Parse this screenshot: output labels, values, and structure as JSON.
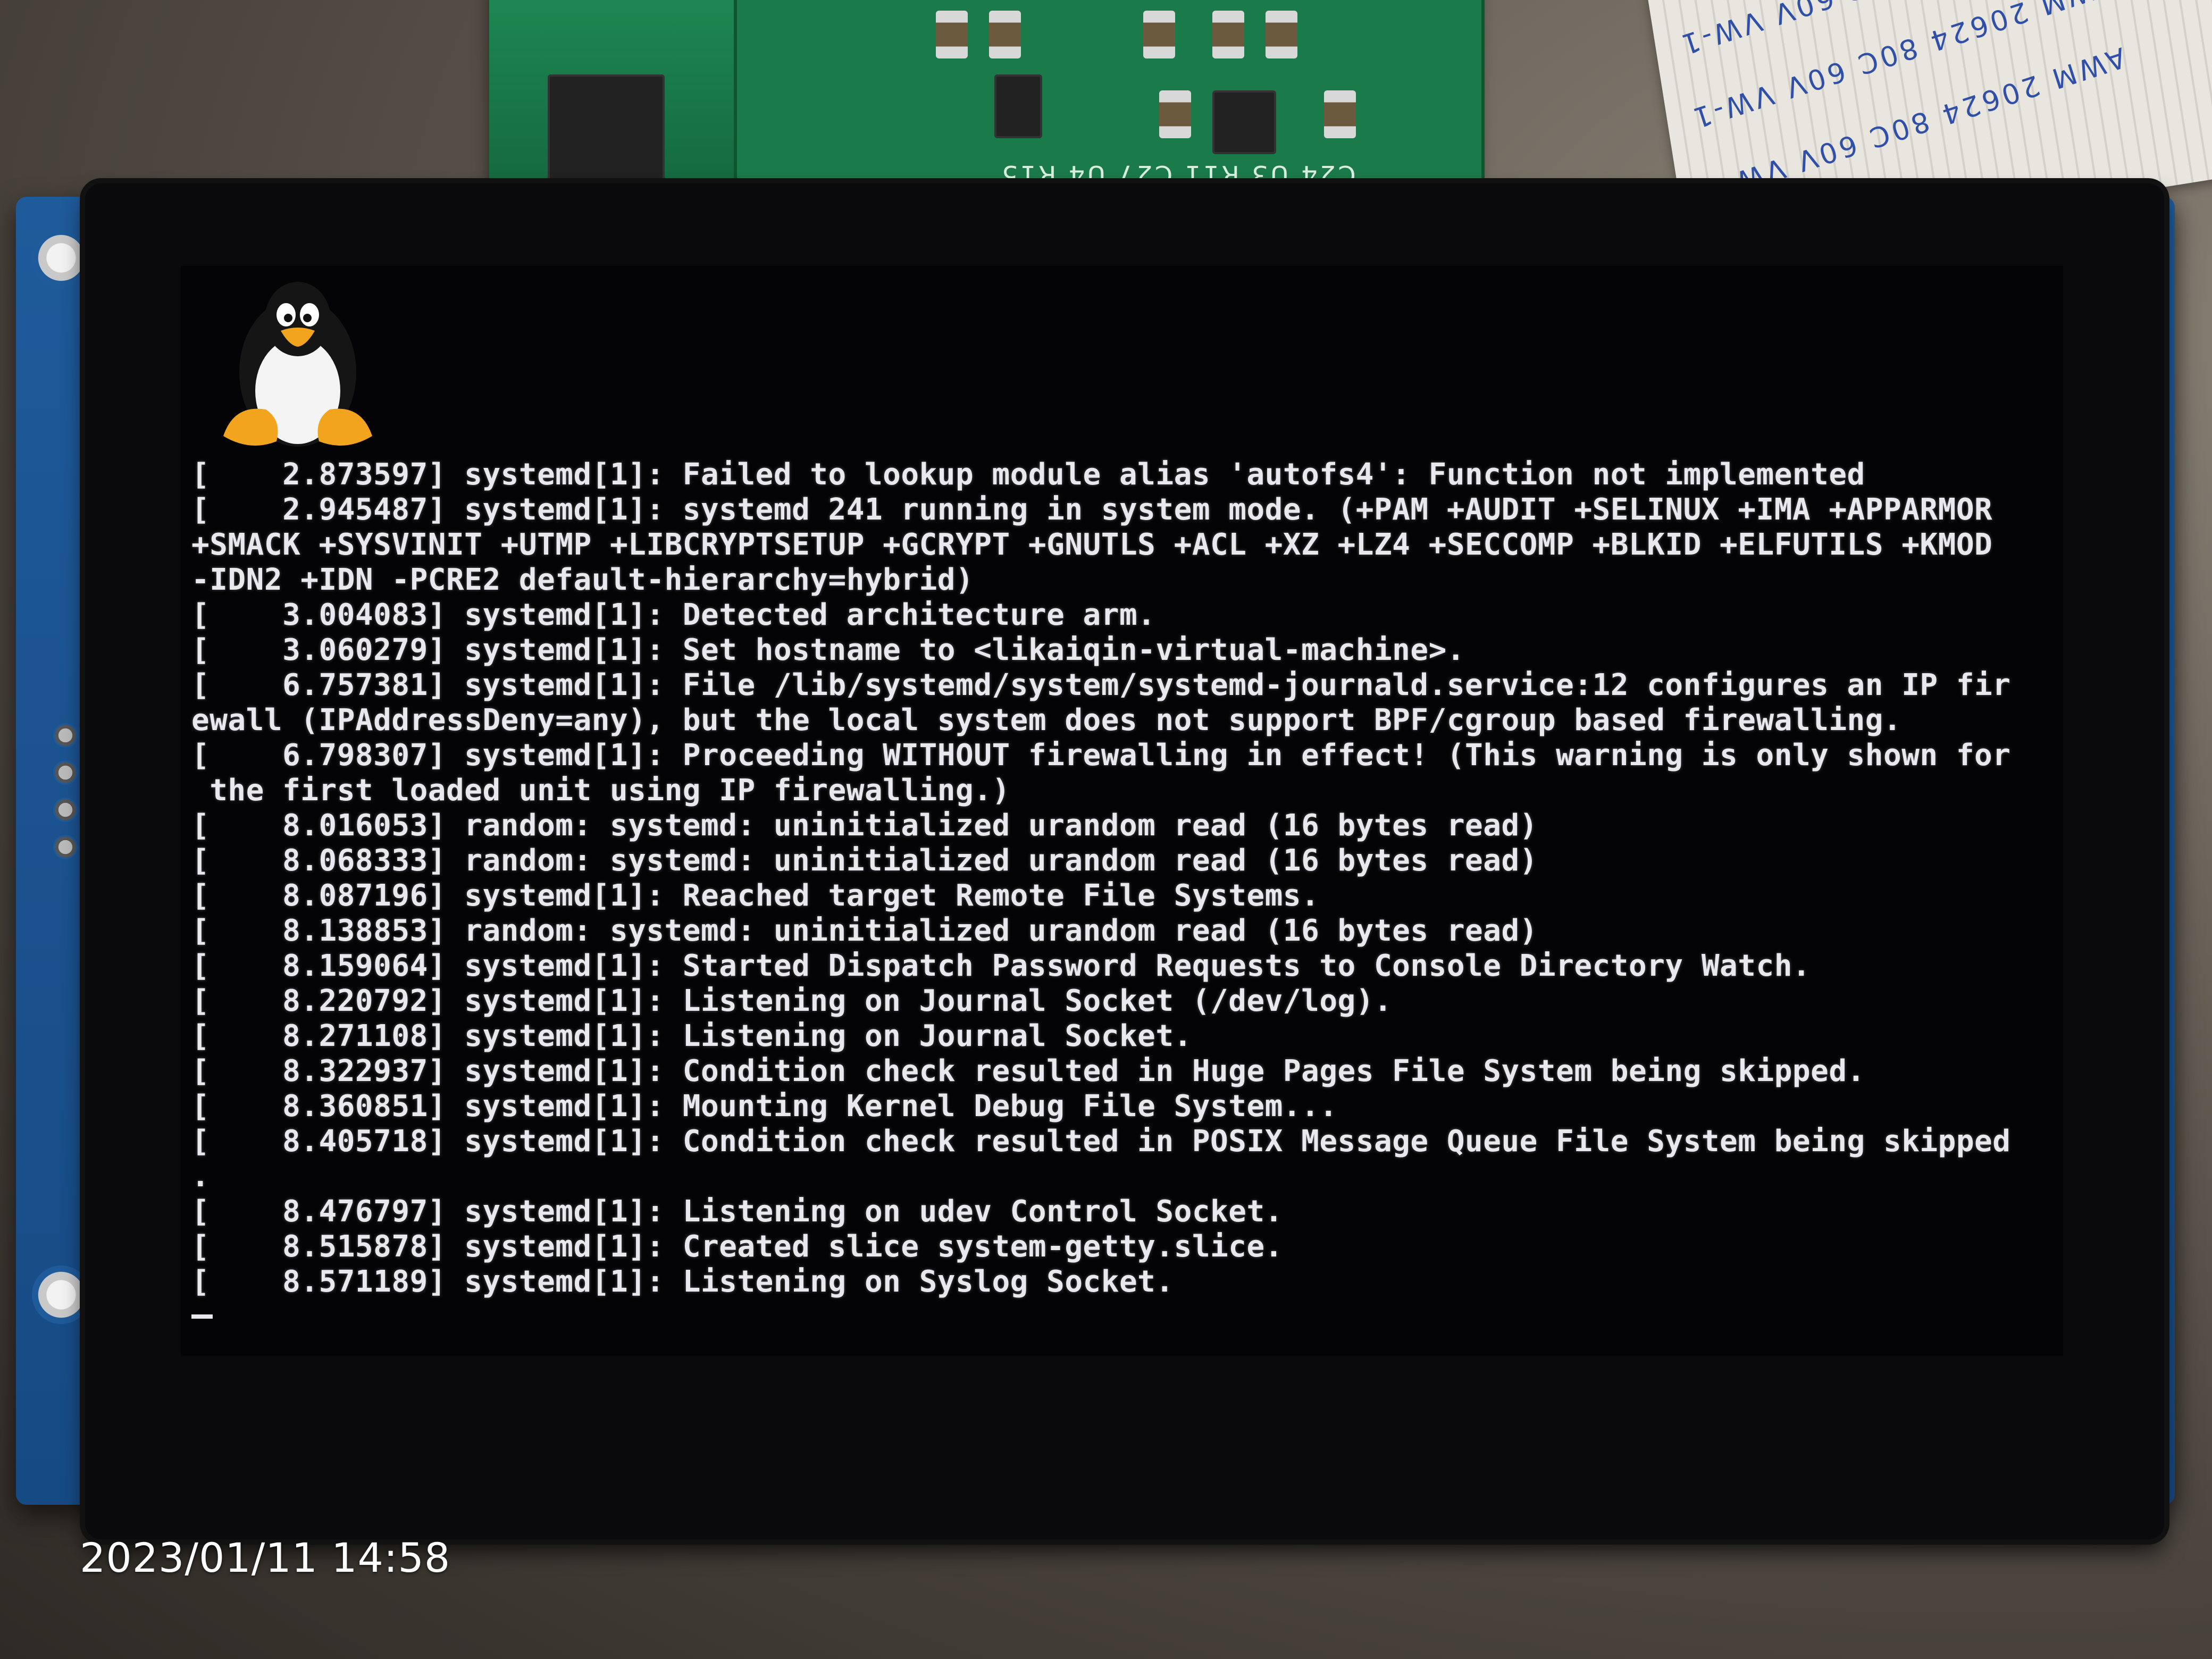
{
  "photo": {
    "timestamp": "2023/01/11 14:58"
  },
  "ribbon": {
    "labels": [
      "AWM 20624 80C 60V VW-1",
      "AWM 20624 80C 60V VW-1",
      "AWM 20624 80C 60V VW-1"
    ]
  },
  "pcb": {
    "silkscreen": "C24 U3 R11 C27 U4 R15"
  },
  "console": {
    "lines": [
      "[    2.873597] systemd[1]: Failed to lookup module alias 'autofs4': Function not implemented",
      "[    2.945487] systemd[1]: systemd 241 running in system mode. (+PAM +AUDIT +SELINUX +IMA +APPARMOR",
      "+SMACK +SYSVINIT +UTMP +LIBCRYPTSETUP +GCRYPT +GNUTLS +ACL +XZ +LZ4 +SECCOMP +BLKID +ELFUTILS +KMOD",
      "-IDN2 +IDN -PCRE2 default-hierarchy=hybrid)",
      "[    3.004083] systemd[1]: Detected architecture arm.",
      "[    3.060279] systemd[1]: Set hostname to <likaiqin-virtual-machine>.",
      "[    6.757381] systemd[1]: File /lib/systemd/system/systemd-journald.service:12 configures an IP fir",
      "ewall (IPAddressDeny=any), but the local system does not support BPF/cgroup based firewalling.",
      "[    6.798307] systemd[1]: Proceeding WITHOUT firewalling in effect! (This warning is only shown for",
      " the first loaded unit using IP firewalling.)",
      "[    8.016053] random: systemd: uninitialized urandom read (16 bytes read)",
      "[    8.068333] random: systemd: uninitialized urandom read (16 bytes read)",
      "[    8.087196] systemd[1]: Reached target Remote File Systems.",
      "[    8.138853] random: systemd: uninitialized urandom read (16 bytes read)",
      "[    8.159064] systemd[1]: Started Dispatch Password Requests to Console Directory Watch.",
      "[    8.220792] systemd[1]: Listening on Journal Socket (/dev/log).",
      "[    8.271108] systemd[1]: Listening on Journal Socket.",
      "[    8.322937] systemd[1]: Condition check resulted in Huge Pages File System being skipped.",
      "[    8.360851] systemd[1]: Mounting Kernel Debug File System...",
      "[    8.405718] systemd[1]: Condition check resulted in POSIX Message Queue File System being skipped",
      ".",
      "[    8.476797] systemd[1]: Listening on udev Control Socket.",
      "[    8.515878] systemd[1]: Created slice system-getty.slice.",
      "[    8.571189] systemd[1]: Listening on Syslog Socket."
    ]
  },
  "colors": {
    "screen_bg": "#040406",
    "console_text": "#e8e8ee",
    "backplate": "#1f5a9a",
    "pcb": "#1a7a4a"
  },
  "icons": {
    "logo": "tux-penguin-icon"
  }
}
